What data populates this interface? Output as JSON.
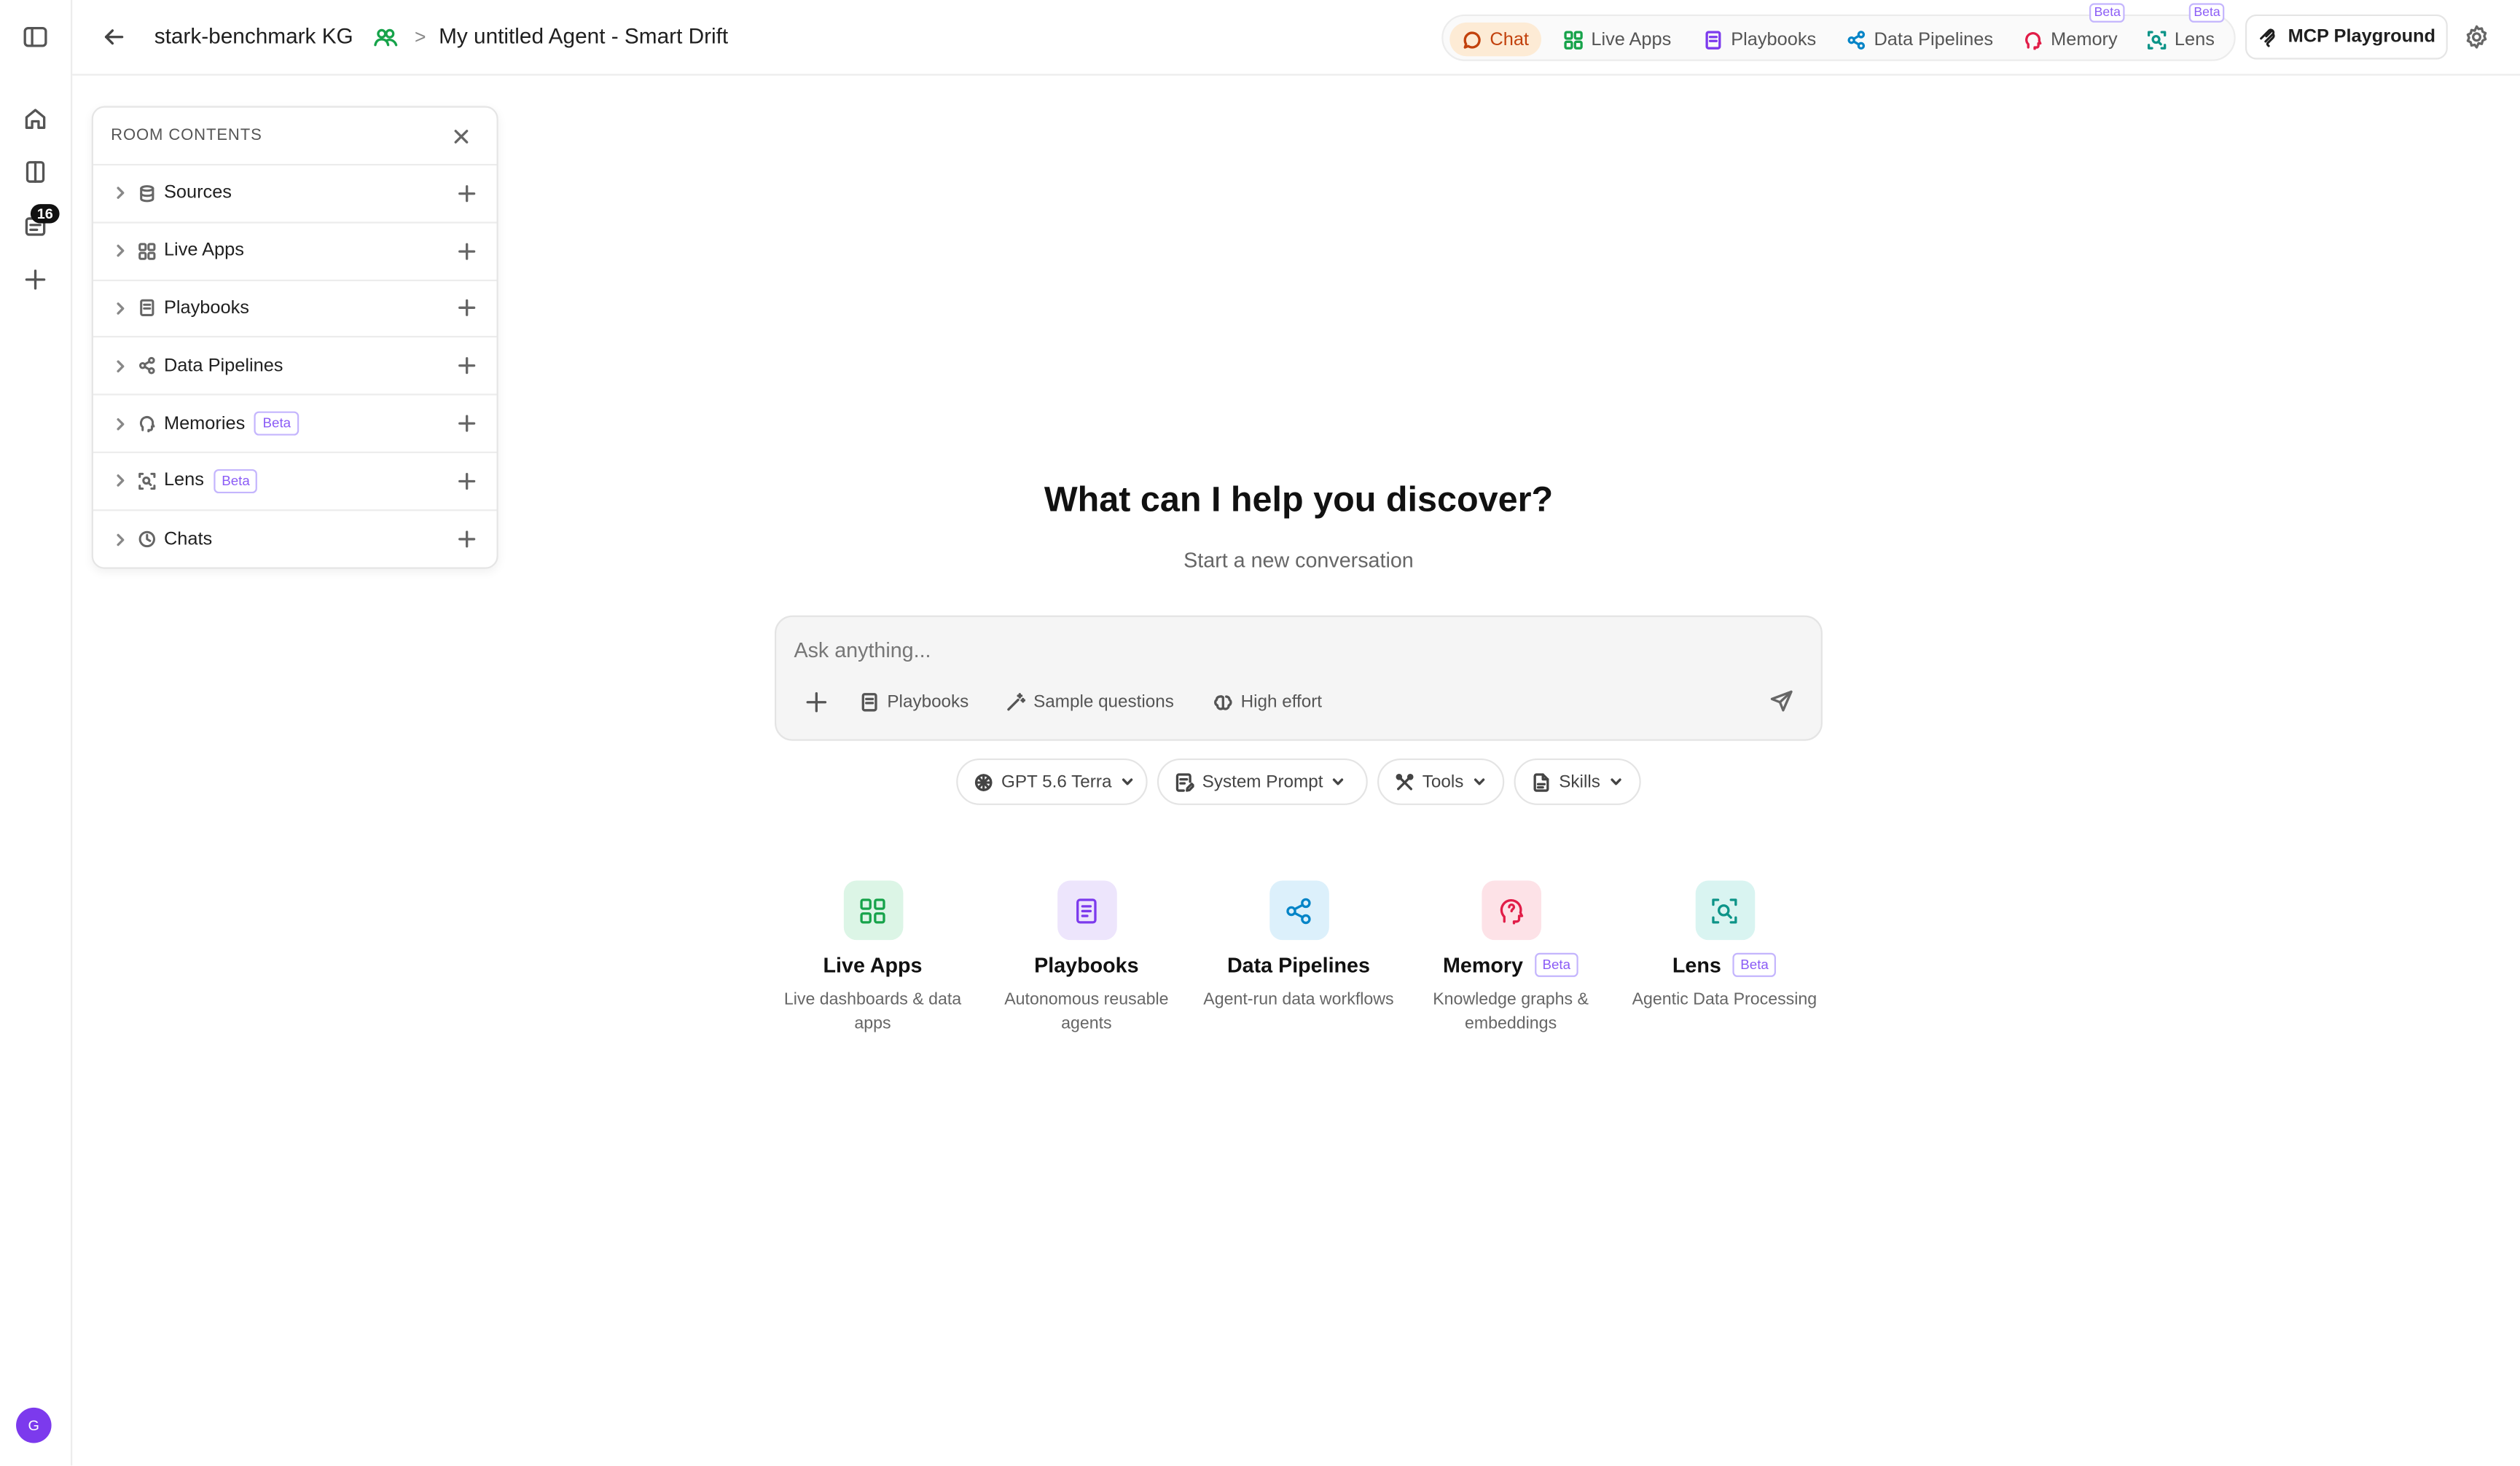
{
  "rail": {
    "badge_count": "16",
    "avatar_initial": "G"
  },
  "header": {
    "workspace": "stark-benchmark KG",
    "separator": ">",
    "agent_title": "My untitled Agent - Smart Drift",
    "nav": {
      "chat": "Chat",
      "live_apps": "Live Apps",
      "playbooks": "Playbooks",
      "data_pipelines": "Data Pipelines",
      "memory": "Memory",
      "lens": "Lens",
      "beta": "Beta"
    },
    "mcp_button": "MCP Playground"
  },
  "room_panel": {
    "title": "ROOM CONTENTS",
    "items": [
      {
        "label": "Sources"
      },
      {
        "label": "Live Apps"
      },
      {
        "label": "Playbooks"
      },
      {
        "label": "Data Pipelines"
      },
      {
        "label": "Memories",
        "badge": "Beta"
      },
      {
        "label": "Lens",
        "badge": "Beta"
      },
      {
        "label": "Chats"
      }
    ]
  },
  "main": {
    "heading": "What can I help you discover?",
    "subheading": "Start a new conversation",
    "input_placeholder": "Ask anything...",
    "composer": {
      "playbooks": "Playbooks",
      "sample_questions": "Sample questions",
      "effort": "High effort"
    },
    "selectors": {
      "model": "GPT 5.6 Terra",
      "system_prompt": "System Prompt",
      "tools": "Tools",
      "skills": "Skills"
    },
    "features": [
      {
        "title": "Live Apps",
        "description": "Live dashboards & data apps"
      },
      {
        "title": "Playbooks",
        "description": "Autonomous reusable agents"
      },
      {
        "title": "Data Pipelines",
        "description": "Agent-run data workflows"
      },
      {
        "title": "Memory",
        "badge": "Beta",
        "description": "Knowledge graphs & embeddings"
      },
      {
        "title": "Lens",
        "badge": "Beta",
        "description": "Agentic Data Processing"
      }
    ]
  },
  "colors": {
    "accent_orange": "#c2410c",
    "chat_active_bg": "#fdebd5",
    "beta_purple": "#8b5cf6",
    "avatar": "#7c3aed",
    "live_apps": "#16a34a",
    "playbooks": "#7c3aed",
    "data_pipelines": "#0284c7",
    "memory": "#e11d48",
    "lens": "#0d9488"
  }
}
